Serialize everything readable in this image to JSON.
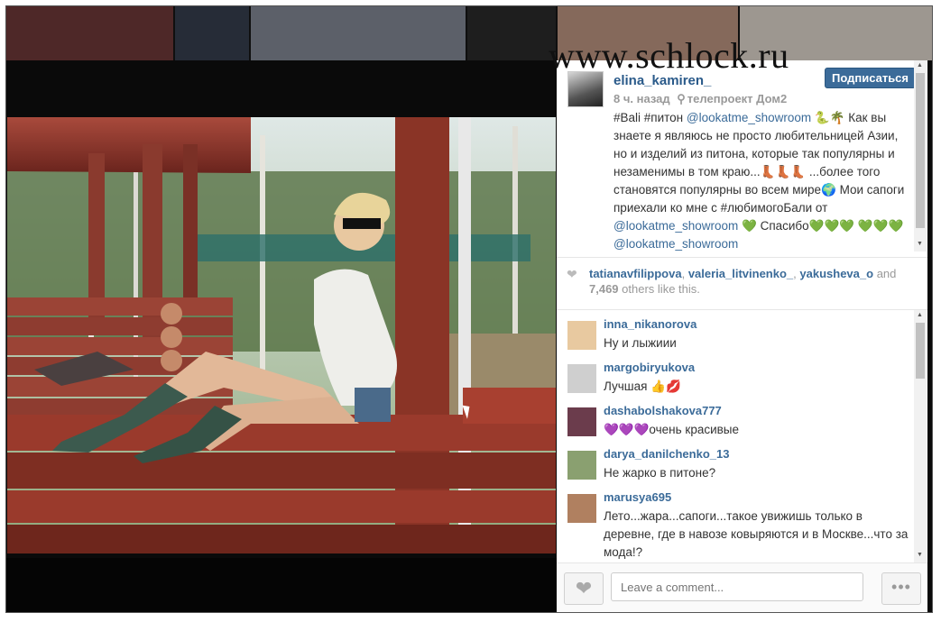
{
  "watermark": "www.schlock.ru",
  "post": {
    "username": "elina_kamiren_",
    "follow_label": "Подписаться",
    "time": "8 ч. назад",
    "location": "телепроект Дом2",
    "caption_parts": [
      {
        "t": "#Bali #питон ",
        "m": false
      },
      {
        "t": "@lookatme_showroom",
        "m": true
      },
      {
        "t": " 🐍🌴 Как вы знаете я являюсь не просто любительницей Азии, но и изделий из питона, которые так популярны и незаменимы в том краю...👢👢👢 ...более того становятся популярны во всем мире🌍 Мои сапоги приехали ко мне с #любимогоБали от ",
        "m": false
      },
      {
        "t": "@lookatme_showroom",
        "m": true
      },
      {
        "t": " 💚 Спасибо💚💚💚 💚💚💚 ",
        "m": false
      },
      {
        "t": "@lookatme_showroom",
        "m": true
      }
    ]
  },
  "likes": {
    "users": [
      "tatianavfilippova",
      "valeria_litvinenko_",
      "yakusheva_o"
    ],
    "and_word": "and",
    "count": "7,469",
    "suffix": "others like this."
  },
  "comments": [
    {
      "user": "inna_nikanorova",
      "text": "Ну и лыжиии",
      "color": "#e8c9a0"
    },
    {
      "user": "margobiryukova",
      "text": "Лучшая 👍💋",
      "color": "#cfcfcf"
    },
    {
      "user": "dashabolshakova777",
      "text": "💜💜💜очень красивые",
      "color": "#6b3c4c"
    },
    {
      "user": "darya_danilchenko_13",
      "text": "Не жарко в питоне?",
      "color": "#8aa070"
    },
    {
      "user": "marusya695",
      "text": "Лето...жара...сапоги...такое увижишь только в деревне, где в навозе ковыряются и в Москве...что за мода!?",
      "color": "#b08060"
    }
  ],
  "comment_box": {
    "placeholder": "Leave a comment...",
    "more": "•••"
  },
  "icons": {
    "like": "heart-icon",
    "location": "location-pin-icon",
    "more": "more-dots-icon"
  }
}
